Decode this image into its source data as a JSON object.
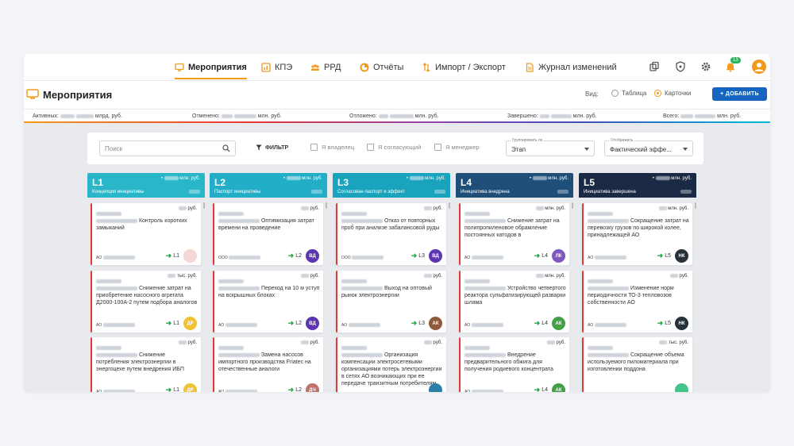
{
  "nav": {
    "items": [
      {
        "label": "Мероприятия",
        "icon": "monitor-icon"
      },
      {
        "label": "КПЭ",
        "icon": "chart-icon"
      },
      {
        "label": "РРД",
        "icon": "people-icon"
      },
      {
        "label": "Отчёты",
        "icon": "pie-icon"
      },
      {
        "label": "Импорт / Экспорт",
        "icon": "swap-icon"
      },
      {
        "label": "Журнал изменений",
        "icon": "document-icon"
      }
    ],
    "notification_count": "13"
  },
  "page": {
    "title": "Мероприятия",
    "view_label": "Вид:",
    "view_table": "Таблица",
    "view_cards": "Карточки",
    "add_button": "+ ДОБАВИТЬ"
  },
  "stats": {
    "active": "Активных:",
    "active_unit": "млрд. руб.",
    "cancelled": "Отменено:",
    "cancelled_unit": "млн. руб.",
    "postponed": "Отложено:",
    "postponed_unit": "млн. руб.",
    "completed": "Завершено:",
    "completed_unit": "млн. руб.",
    "total": "Всего:",
    "total_unit": "млн. руб."
  },
  "filters": {
    "search_placeholder": "Поиск",
    "filter_label": "ФИЛЬТР",
    "owner": "Я владелец",
    "approver": "Я согласующий",
    "manager": "Я менеджер",
    "group_label": "Группировать по",
    "group_value": "Этап",
    "display_label": "Отображать",
    "display_value": "Фактический эффе..."
  },
  "columns": [
    {
      "level": "L1",
      "subtitle": "Концепция инициативы",
      "unit": "млн. руб.",
      "color": "#29b6c9",
      "cards": [
        {
          "amount": "руб.",
          "title": "Контроль коротких замыканий",
          "org": "АО",
          "level": "L1",
          "initials": "",
          "avatar_color": "#f3d7d7"
        },
        {
          "amount": "тыс. руб.",
          "title": "Снижение затрат на приобретение насосного агрегата Д2000-100А-2 путем подбора аналогов",
          "org": "АО",
          "level": "L1",
          "initials": "ДР",
          "avatar_color": "#f1c232"
        },
        {
          "amount": "руб.",
          "title": "Снижение потребления электроэнергии в энергоцехе путем внедрения ИБП",
          "org": "АО",
          "level": "L1",
          "initials": "ДР",
          "avatar_color": "#f1c232"
        }
      ]
    },
    {
      "level": "L2",
      "subtitle": "Паспорт инициативы",
      "unit": "млн. руб.",
      "color": "#23aec8",
      "cards": [
        {
          "amount": "руб.",
          "title": "Оптимизация затрат времени на проведение",
          "org": "ООО",
          "level": "L2",
          "initials": "ВД",
          "avatar_color": "#5e35b1"
        },
        {
          "amount": "руб.",
          "title": "Переход на 10 м уступ на вскрышных блоках",
          "org": "АО",
          "level": "L2",
          "initials": "ВД",
          "avatar_color": "#5e35b1"
        },
        {
          "amount": "руб.",
          "title": "Замена насосов импортного производства Friatec на отечественные аналоги",
          "org": "АО",
          "level": "L2",
          "initials": "ДЧ",
          "avatar_color": "#c0736a"
        }
      ]
    },
    {
      "level": "L3",
      "subtitle": "Согласован паспорт и эффект",
      "unit": "млн. руб.",
      "color": "#1aa3bd",
      "cards": [
        {
          "amount": "руб.",
          "title": "Отказ от повторных проб при анализе забалансовой руды",
          "org": "ООО",
          "level": "L3",
          "initials": "ВД",
          "avatar_color": "#5e35b1"
        },
        {
          "amount": "руб.",
          "title": "Выход на оптовый рынок электроэнергии",
          "org": "АО",
          "level": "L3",
          "initials": "АК",
          "avatar_color": "#8d5a3b"
        },
        {
          "amount": "руб.",
          "title": "Организация компенсации электросетевыми организациями потерь электроэнергии в сетях АО возникающих при ее передаче транзитным потребителям",
          "org": "",
          "level": "",
          "initials": "",
          "avatar_color": "#2e7fa8"
        }
      ]
    },
    {
      "level": "L4",
      "subtitle": "Инициатива внедрена",
      "unit": "млн. руб.",
      "color": "#1f4e79",
      "cards": [
        {
          "amount": "млн. руб.",
          "title": "Снижение затрат на полипропиленовое обрамление постоянных катодов в",
          "org": "АО",
          "level": "L4",
          "initials": "ЛК",
          "avatar_color": "#7e57c2"
        },
        {
          "amount": "млн. руб.",
          "title": "Устройство четвертого реактора сульфатизирующей разварки шлама",
          "org": "АО",
          "level": "L4",
          "initials": "АК",
          "avatar_color": "#43a047"
        },
        {
          "amount": "руб.",
          "title": "Внедрение предварительного обжига для получения родиевого концентрата",
          "org": "АО",
          "level": "L4",
          "initials": "АК",
          "avatar_color": "#43a047"
        }
      ]
    },
    {
      "level": "L5",
      "subtitle": "Инициатива завершена",
      "unit": "млн. руб.",
      "color": "#1b2a44",
      "cards": [
        {
          "amount": "млн. руб.",
          "title": "Сокращение затрат на перевозку грузов по широкой колее, принадлежащей АО",
          "org": "АО",
          "level": "L5",
          "initials": "НК",
          "avatar_color": "#263238"
        },
        {
          "amount": "руб.",
          "title": "Изменение норм периодичности ТО-3 тепловозов собственности АО",
          "org": "АО",
          "level": "L5",
          "initials": "НК",
          "avatar_color": "#263238"
        },
        {
          "amount": "тыс. руб.",
          "title": "Сокращение объема используемого пиломатериала при изготовлении поддона",
          "org": "",
          "level": "",
          "initials": "",
          "avatar_color": "#43c489"
        }
      ]
    }
  ]
}
